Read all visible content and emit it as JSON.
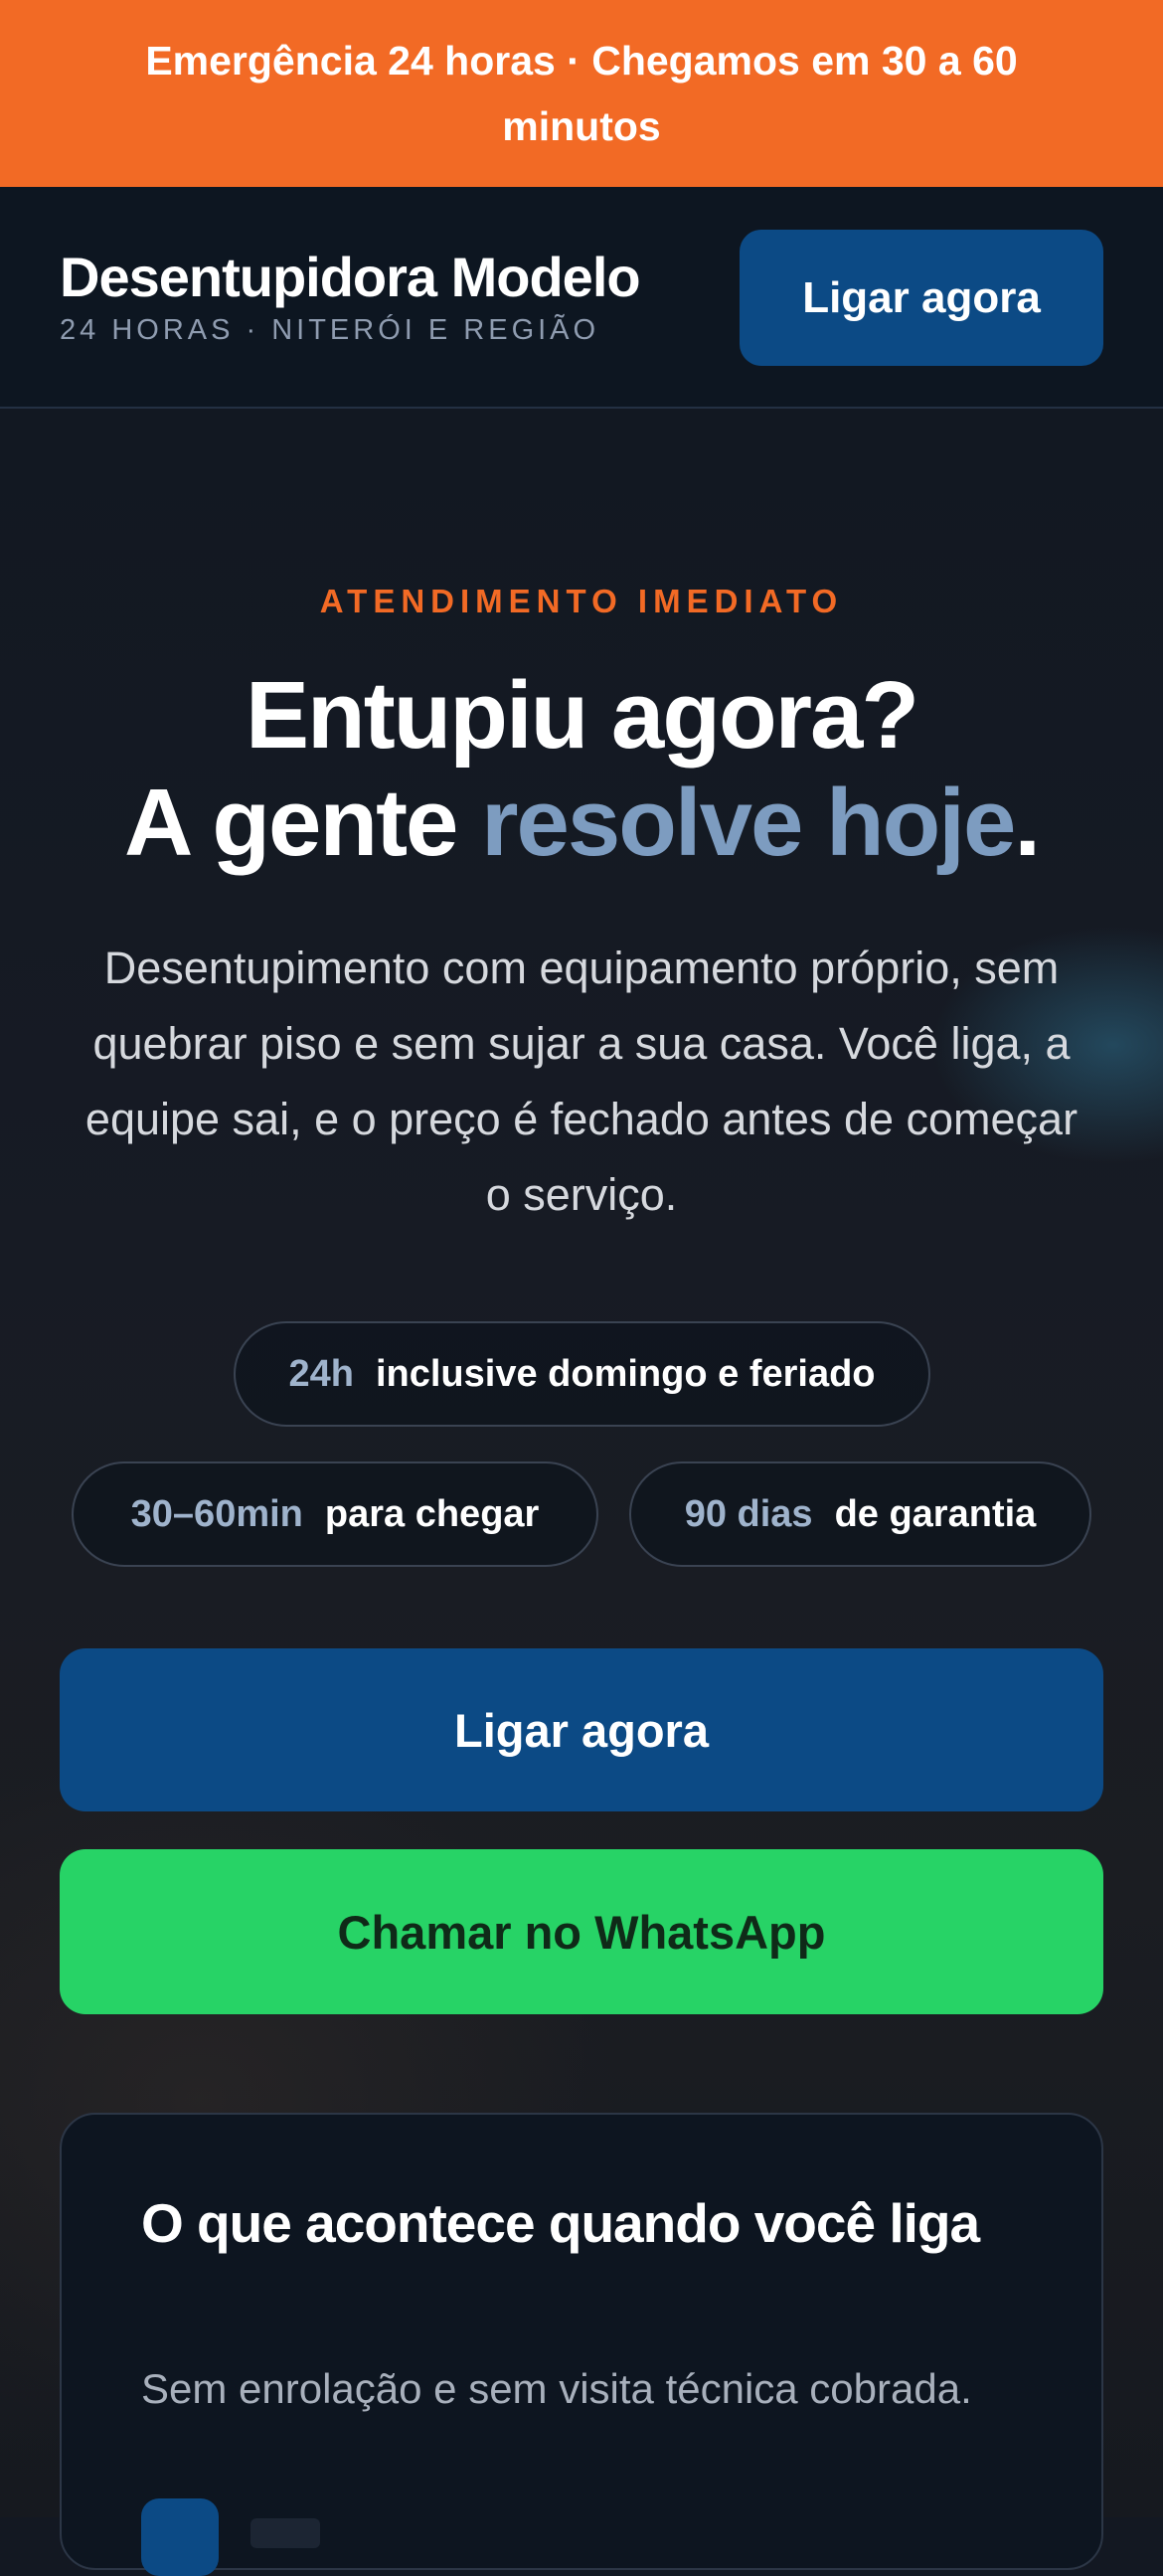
{
  "top_banner": {
    "text": "Emergência 24 horas · Chegamos em 30 a 60 minutos"
  },
  "header": {
    "brand_name": "Desentupidora Modelo",
    "brand_tagline": "24 HORAS · NITERÓI E REGIÃO",
    "call_button_label": "Ligar agora"
  },
  "hero": {
    "eyebrow": "ATENDIMENTO IMEDIATO",
    "headline_line1": "Entupiu agora?",
    "headline_line2_prefix": "A gente ",
    "headline_line2_highlight": "resolve hoje",
    "headline_line2_suffix": ".",
    "lead": "Desentupimento com equipamento próprio, sem quebrar piso e sem sujar a sua casa. Você liga, a equipe sai, e o preço é fechado antes de começar o serviço.",
    "pills": [
      {
        "key": "24h",
        "value": "inclusive domingo e feriado"
      },
      {
        "key": "30–60min",
        "value": "para chegar"
      },
      {
        "key": "90 dias",
        "value": "de garantia"
      }
    ],
    "primary_cta": "Ligar agora",
    "secondary_cta": "Chamar no WhatsApp"
  },
  "process_card": {
    "title": "O que acontece quando você liga",
    "subtitle": "Sem enrolação e sem visita técnica cobrada."
  },
  "colors": {
    "accent_orange": "#f26a25",
    "brand_blue": "#0c4a85",
    "highlight_blue": "#7d9cc0",
    "whatsapp_green": "#27d366",
    "background_dark": "#131822"
  }
}
